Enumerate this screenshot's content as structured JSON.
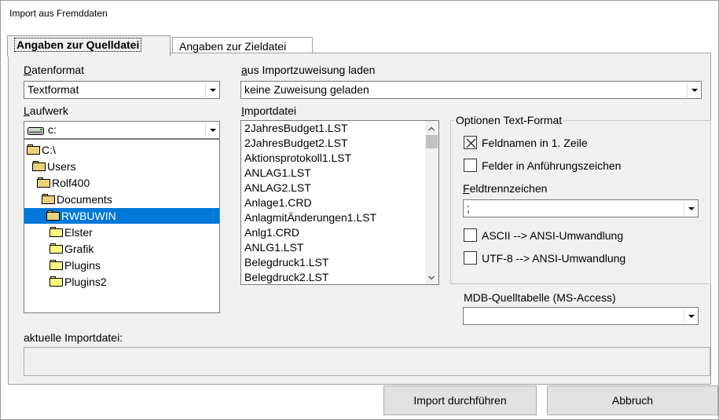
{
  "window": {
    "title": "Import aus Fremddaten"
  },
  "tabs": [
    {
      "label": "Angaben zur Quelldatei"
    },
    {
      "label": "Angaben zur Zieldatei"
    }
  ],
  "datenformat": {
    "label_u": "D",
    "label_rest": "atenformat",
    "value": "Textformat"
  },
  "importzuweisung": {
    "label_pre": "",
    "label_u": "a",
    "label_rest": "us Importzuweisung laden",
    "value": "keine Zuweisung geladen"
  },
  "laufwerk": {
    "label_u": "L",
    "label_rest": "aufwerk",
    "value": "c:",
    "icon": "drive-icon"
  },
  "tree": [
    {
      "label": "C:\\",
      "state": "open"
    },
    {
      "label": "Users",
      "state": "open"
    },
    {
      "label": "Rolf400",
      "state": "open"
    },
    {
      "label": "Documents",
      "state": "open"
    },
    {
      "label": "RWBUWIN",
      "state": "open",
      "selected": true
    },
    {
      "label": "Elster",
      "state": "closed"
    },
    {
      "label": "Grafik",
      "state": "closed"
    },
    {
      "label": "Plugins",
      "state": "closed"
    },
    {
      "label": "Plugins2",
      "state": "closed"
    }
  ],
  "importdatei": {
    "label_u": "I",
    "label_rest": "mportdatei",
    "files": [
      "2JahresBudget1.LST",
      "2JahresBudget2.LST",
      "Aktionsprotokoll1.LST",
      "ANLAG1.LST",
      "ANLAG2.LST",
      "Anlage1.CRD",
      "AnlagmitÄnderungen1.LST",
      "Anlg1.CRD",
      "ANLG1.LST",
      "Belegdruck1.LST",
      "Belegdruck2.LST"
    ]
  },
  "optionen": {
    "title": "Optionen Text-Format",
    "feldnamen": {
      "label": "Feldnamen in 1. Zeile",
      "checked": true
    },
    "anfuehrung": {
      "label": "Felder in Anführungszeichen",
      "checked": false
    },
    "feldtrenn": {
      "label_u": "F",
      "label_rest": "eldtrennzeichen",
      "value": ";"
    },
    "ascii": {
      "label": "ASCII --> ANSI-Umwandlung",
      "checked": false
    },
    "utf8": {
      "label": "UTF-8 --> ANSI-Umwandlung",
      "checked": false
    }
  },
  "mdb": {
    "label": "MDB-Quelltabelle (MS-Access)",
    "value": ""
  },
  "aktuelle": {
    "label": "aktuelle Importdatei:",
    "value": ""
  },
  "buttons": {
    "import": "Import durchführen",
    "abbruch": "Abbruch"
  }
}
